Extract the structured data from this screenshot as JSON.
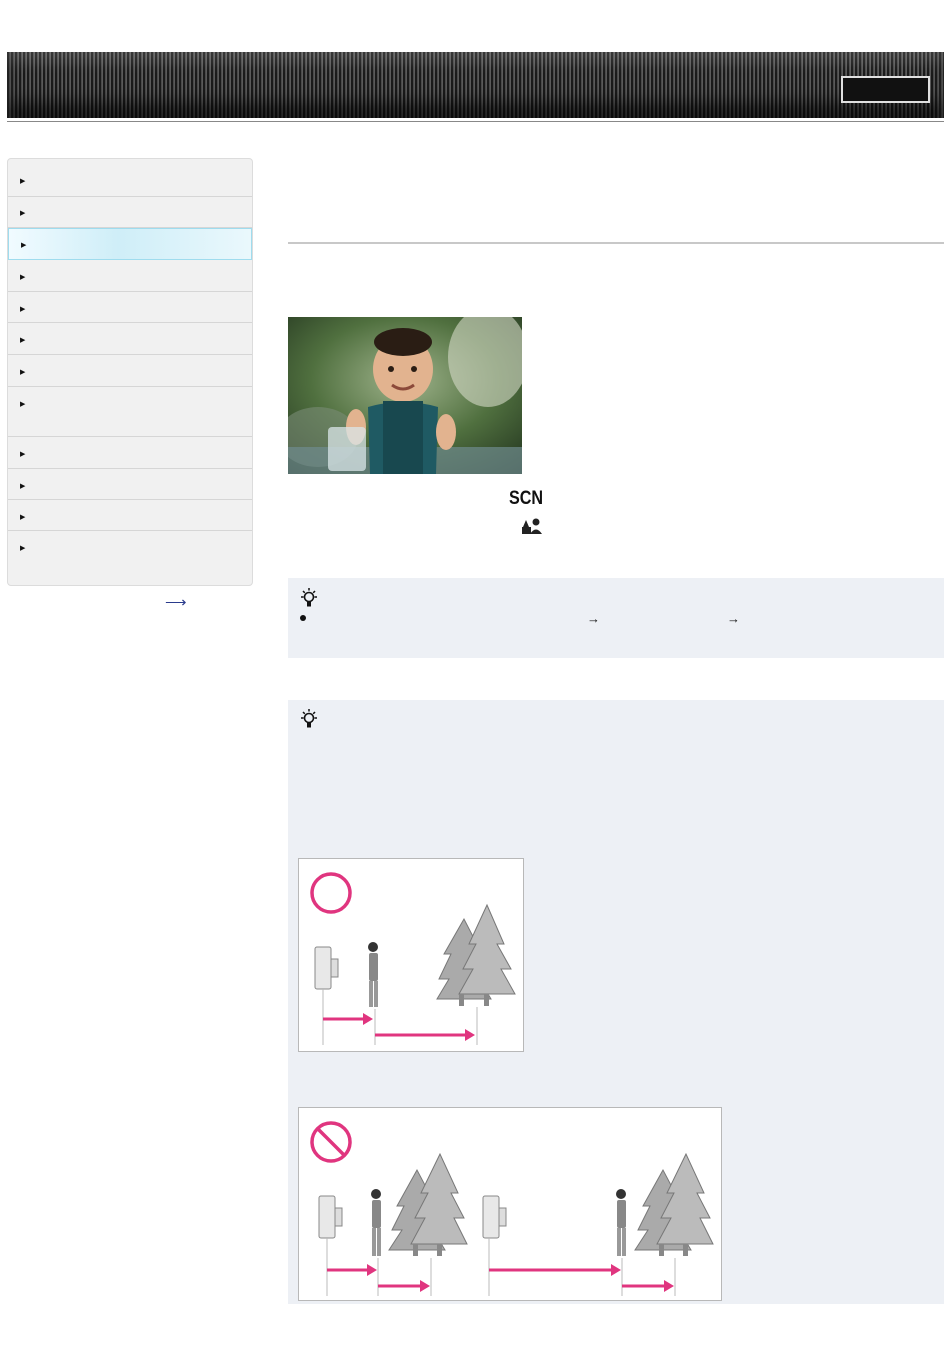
{
  "header": {
    "button_label": ""
  },
  "sidebar": {
    "items": [
      {
        "label": ""
      },
      {
        "label": ""
      },
      {
        "label": ""
      },
      {
        "label": ""
      },
      {
        "label": ""
      },
      {
        "label": ""
      },
      {
        "label": ""
      },
      {
        "label": ""
      },
      {
        "label": ""
      },
      {
        "label": ""
      },
      {
        "label": ""
      },
      {
        "label": ""
      }
    ],
    "active_index": 2,
    "more_icon": "right-arrow-icon"
  },
  "content": {
    "scene_mode_label": "SCN",
    "scene_icon": "soft-snap-icon",
    "hint1": {
      "icon": "lightbulb-icon",
      "path_arrows": [
        "→",
        "→"
      ]
    },
    "hint2": {
      "icon": "lightbulb-icon",
      "good_example_icon": "circle-ok-icon",
      "bad_example_icon": "prohibited-icon"
    }
  },
  "colors": {
    "accent_magenta": "#e0357f",
    "hint_background": "#edf0f5",
    "active_sidebar": "#cfeef8",
    "header_dark": "#1a1a1a"
  }
}
